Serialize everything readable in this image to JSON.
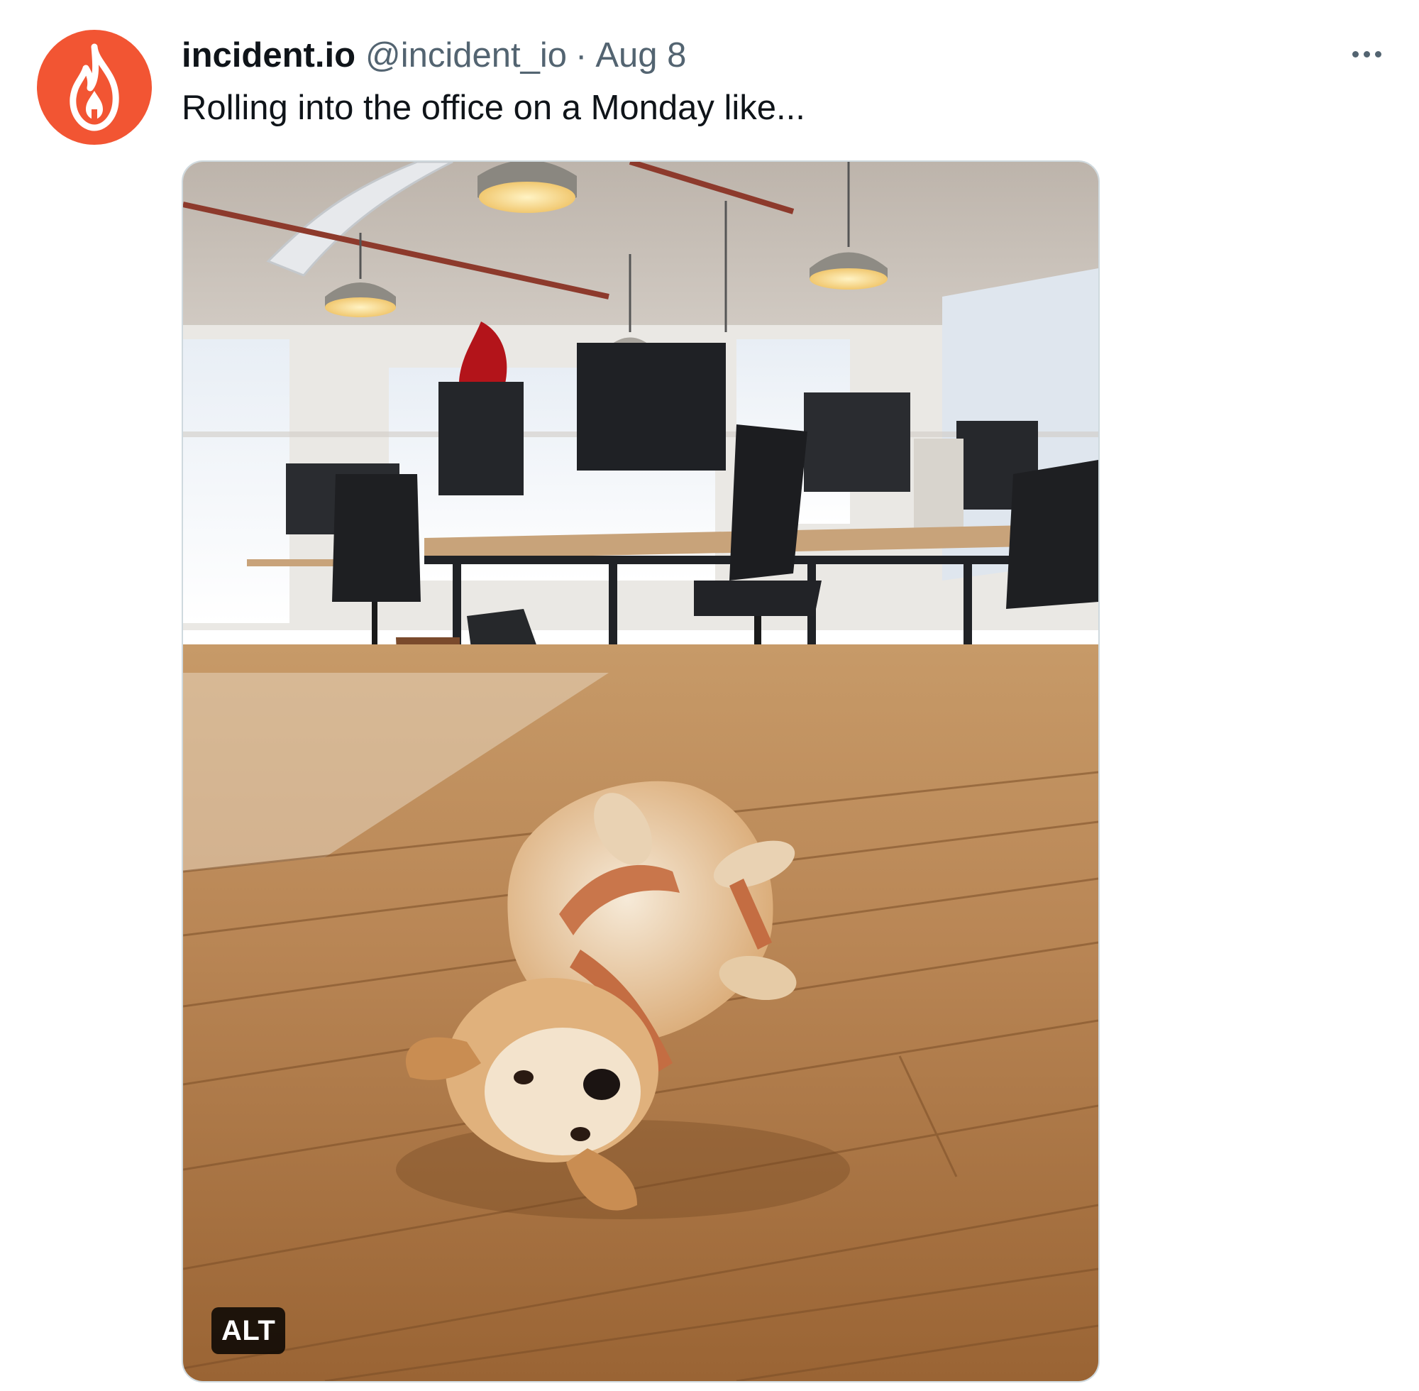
{
  "tweet": {
    "author": {
      "display_name": "incident.io",
      "handle": "@incident_io",
      "avatar_icon": "flame-logo-icon",
      "avatar_color": "#f25533"
    },
    "separator": "·",
    "date": "Aug 8",
    "text": "Rolling into the office on a Monday like...",
    "more_icon": "more-horizontal-icon",
    "media": {
      "subject": "corgi lying on its back on wooden office floor",
      "alt_badge": "ALT"
    }
  },
  "colors": {
    "primary_text": "#0f1419",
    "secondary_text": "#536471",
    "brand": "#f25533",
    "border": "#cfd9de"
  }
}
